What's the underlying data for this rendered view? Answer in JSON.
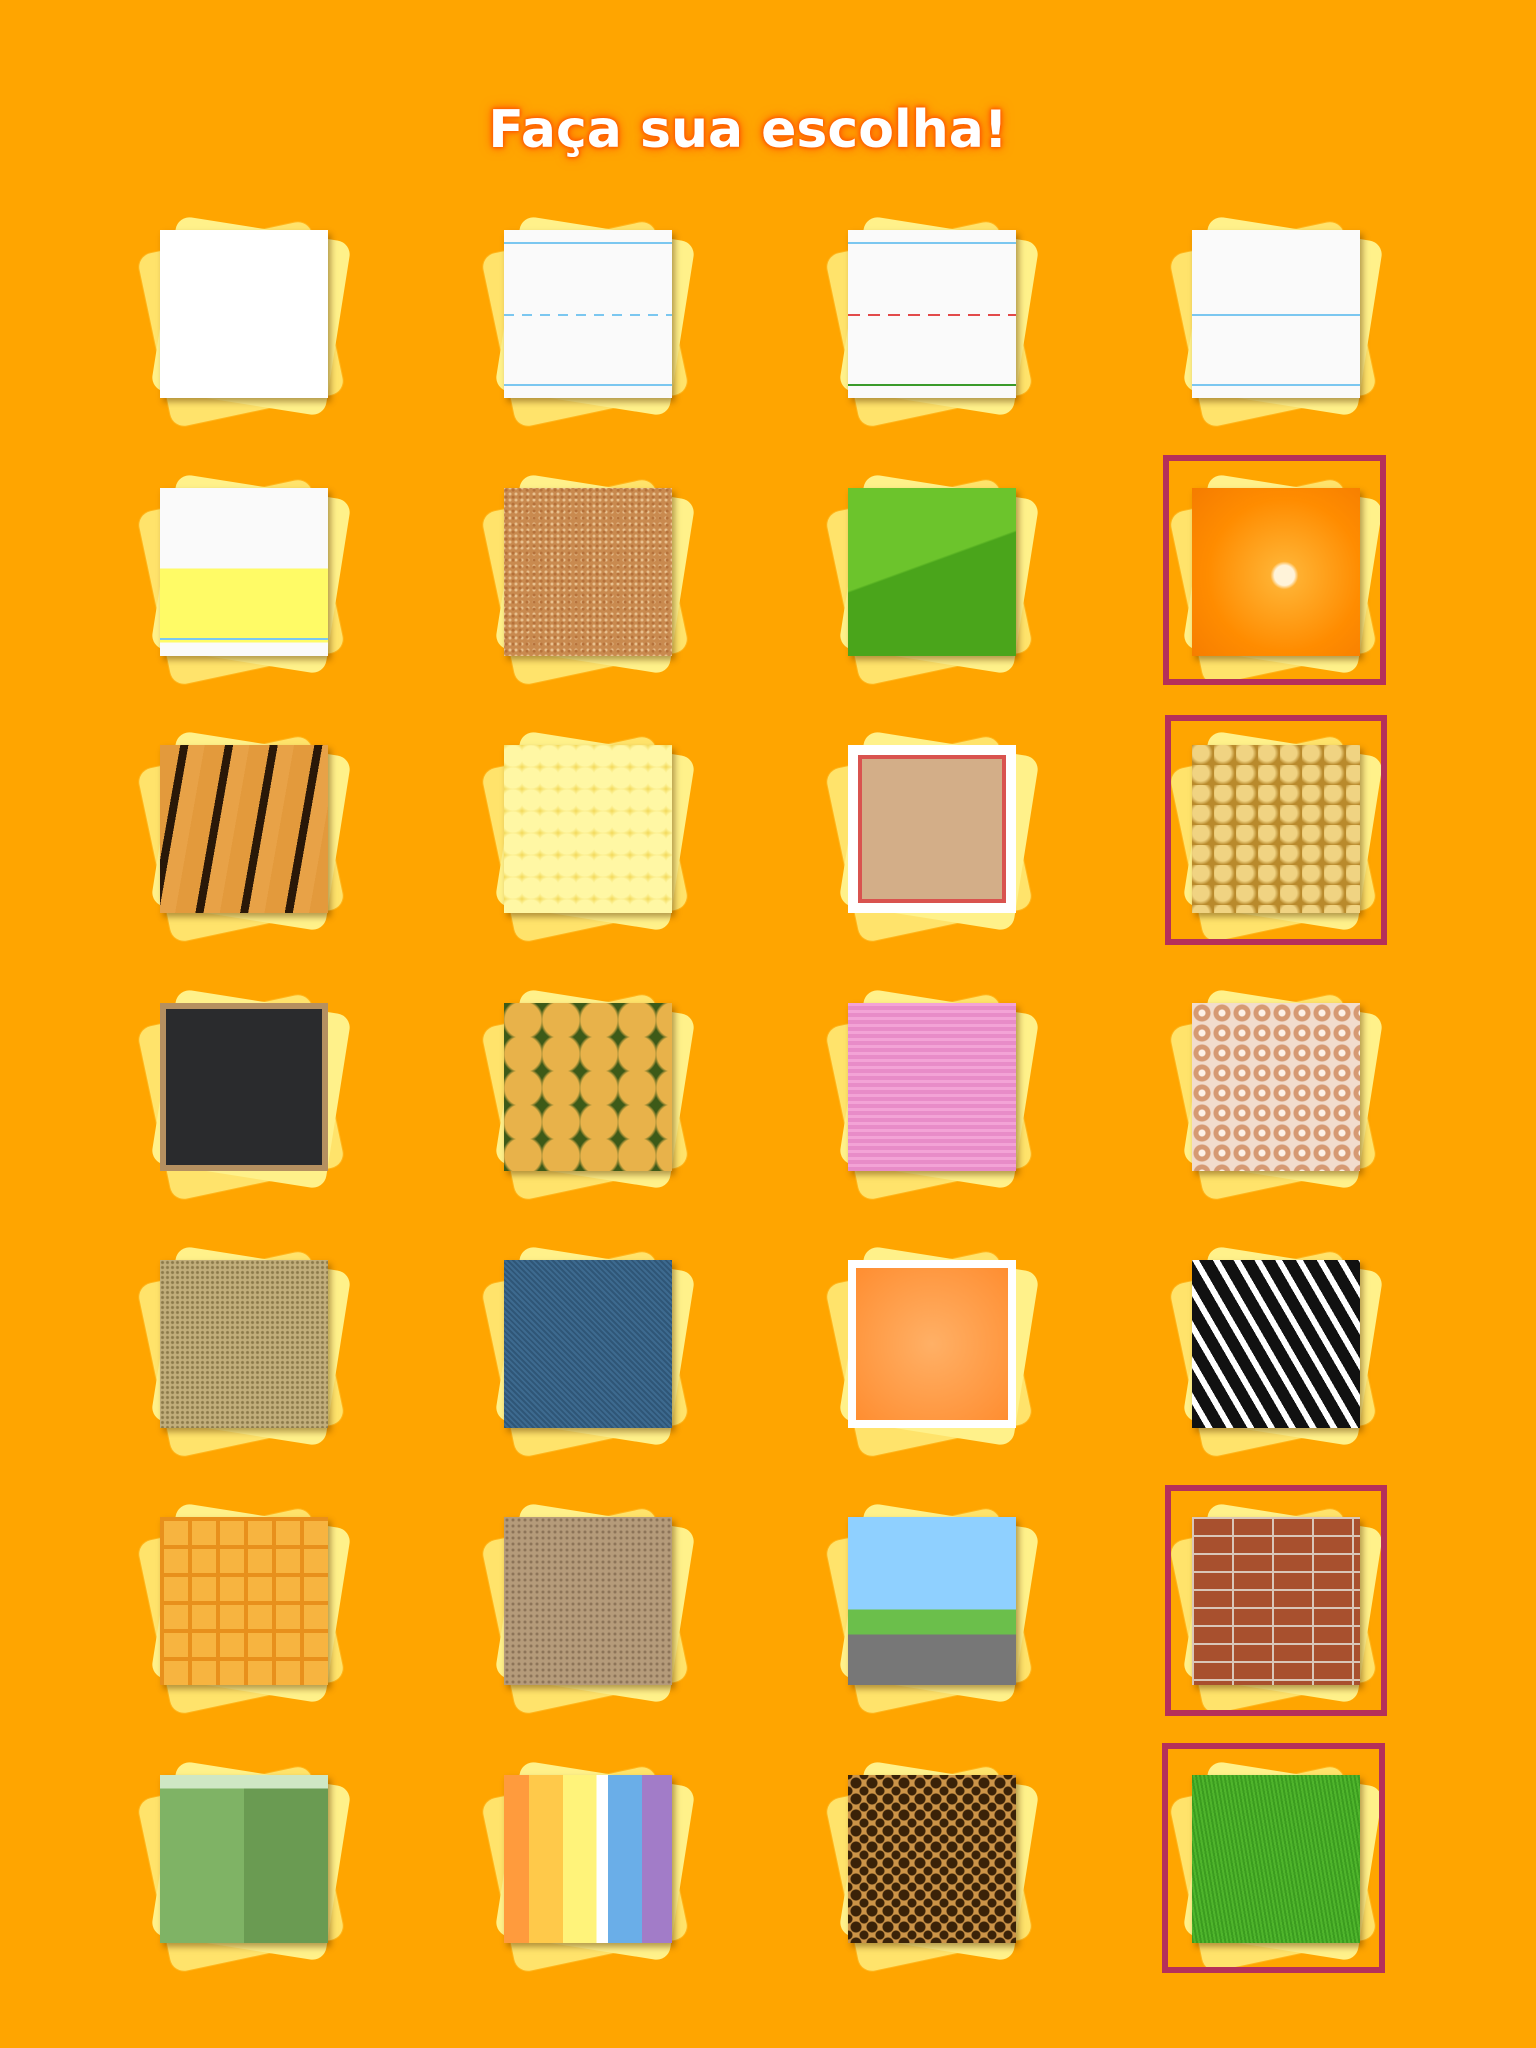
{
  "screen": {
    "title": "Faça sua escolha!",
    "accent_color": "#FFA500",
    "selection_color": "#B5305A"
  },
  "tiles": [
    {
      "id": "blank-paper",
      "icon": "blank-paper",
      "selected": false
    },
    {
      "id": "blue-lined-paper",
      "icon": "lined-paper-blue",
      "selected": false
    },
    {
      "id": "red-dashed-paper",
      "icon": "lined-paper-red",
      "selected": false
    },
    {
      "id": "double-lined-paper",
      "icon": "lined-paper-double",
      "selected": false
    },
    {
      "id": "yellow-band-paper",
      "icon": "yellow-band-paper",
      "selected": false
    },
    {
      "id": "cork-board",
      "icon": "cork",
      "selected": false
    },
    {
      "id": "green-leaf",
      "icon": "leaf",
      "selected": false
    },
    {
      "id": "orange-slice",
      "icon": "orange",
      "selected": true
    },
    {
      "id": "tiger-fur",
      "icon": "tiger",
      "selected": false
    },
    {
      "id": "corn",
      "icon": "corn",
      "selected": false
    },
    {
      "id": "decorative-frame",
      "icon": "frame",
      "selected": false
    },
    {
      "id": "raisins",
      "icon": "raisins",
      "selected": true
    },
    {
      "id": "chalkboard",
      "icon": "chalkboard",
      "selected": false
    },
    {
      "id": "pineapple",
      "icon": "pineapple",
      "selected": false
    },
    {
      "id": "pink-fabric",
      "icon": "fabric",
      "selected": false
    },
    {
      "id": "cereal-rings",
      "icon": "cereal",
      "selected": false
    },
    {
      "id": "sand",
      "icon": "sand",
      "selected": false
    },
    {
      "id": "denim",
      "icon": "denim",
      "selected": false
    },
    {
      "id": "orange-watercolor",
      "icon": "watercolor",
      "selected": false
    },
    {
      "id": "zebra",
      "icon": "zebra",
      "selected": false
    },
    {
      "id": "waffle",
      "icon": "waffle",
      "selected": false
    },
    {
      "id": "beach-frame",
      "icon": "beach",
      "selected": false
    },
    {
      "id": "road-scene",
      "icon": "road",
      "selected": false
    },
    {
      "id": "bricks",
      "icon": "bricks",
      "selected": true
    },
    {
      "id": "map-scene",
      "icon": "map",
      "selected": false
    },
    {
      "id": "rainbow-watercolor",
      "icon": "rainbow",
      "selected": false
    },
    {
      "id": "leopard",
      "icon": "leopard",
      "selected": false
    },
    {
      "id": "grass",
      "icon": "grass",
      "selected": true
    }
  ]
}
